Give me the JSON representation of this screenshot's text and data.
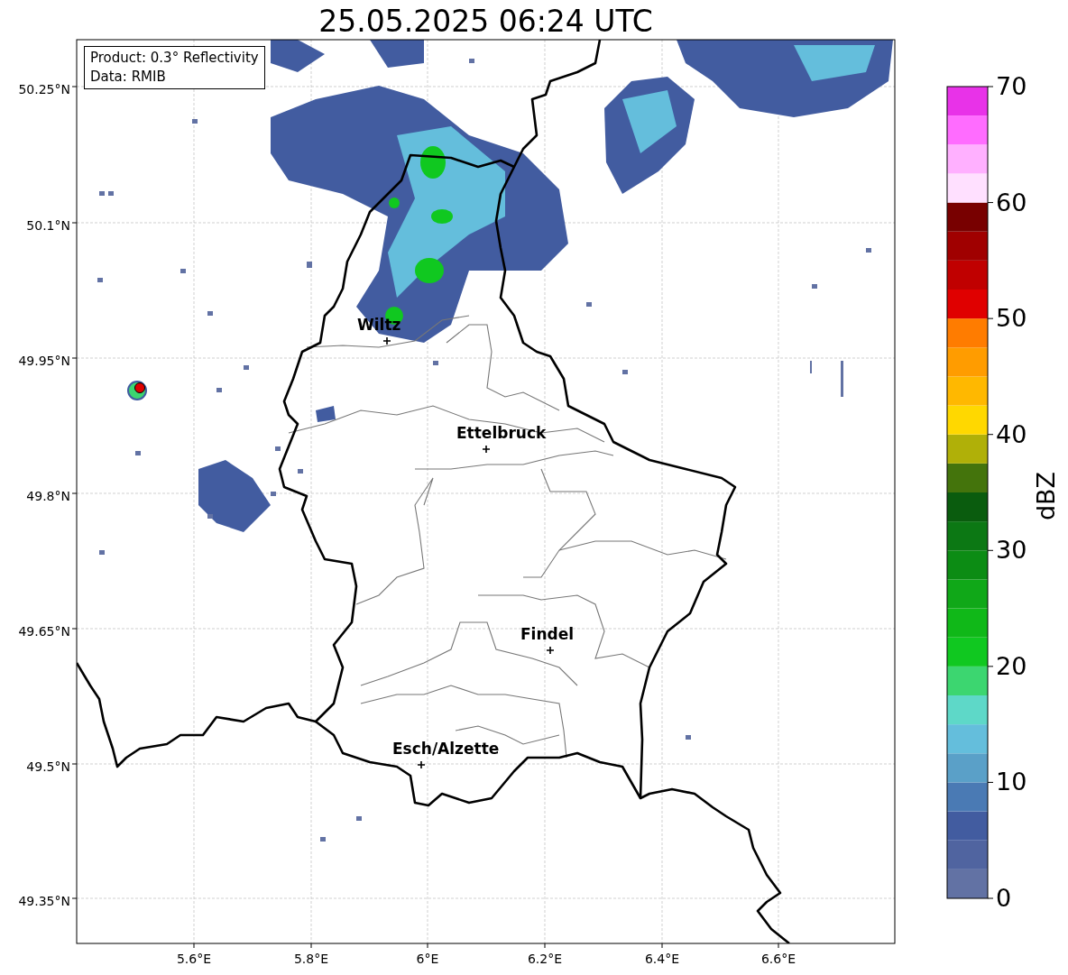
{
  "title": "25.05.2025 06:24 UTC",
  "info_box": {
    "lines": [
      "Product: 0.3° Reflectivity",
      "Data: RMIB"
    ]
  },
  "map": {
    "x_ticks": [
      "5.6°E",
      "5.8°E",
      "6°E",
      "6.2°E",
      "6.4°E",
      "6.6°E"
    ],
    "y_ticks": [
      "50.25°N",
      "50.1°N",
      "49.95°N",
      "49.8°N",
      "49.65°N",
      "49.5°N",
      "49.35°N"
    ],
    "places": [
      {
        "name": "Wiltz"
      },
      {
        "name": "Ettelbruck"
      },
      {
        "name": "Findel"
      },
      {
        "name": "Esch/Alzette"
      }
    ]
  },
  "colorbar": {
    "label": "dBZ",
    "ticks": [
      "70",
      "60",
      "50",
      "40",
      "30",
      "20",
      "10",
      "0"
    ],
    "bands": [
      {
        "color": "#6272a4"
      },
      {
        "color": "#5064a0"
      },
      {
        "color": "#425ca0"
      },
      {
        "color": "#4a7ab4"
      },
      {
        "color": "#5aa0c8"
      },
      {
        "color": "#64bedc"
      },
      {
        "color": "#5ed8c8"
      },
      {
        "color": "#3cd670"
      },
      {
        "color": "#10c820"
      },
      {
        "color": "#10b818"
      },
      {
        "color": "#10a818"
      },
      {
        "color": "#0c8c14"
      },
      {
        "color": "#0c7814"
      },
      {
        "color": "#0a5c0e"
      },
      {
        "color": "#44740c"
      },
      {
        "color": "#b0b008"
      },
      {
        "color": "#ffd800"
      },
      {
        "color": "#ffb800"
      },
      {
        "color": "#ff9c00"
      },
      {
        "color": "#ff7c00"
      },
      {
        "color": "#e00000"
      },
      {
        "color": "#c00000"
      },
      {
        "color": "#a00000"
      },
      {
        "color": "#780000"
      },
      {
        "color": "#ffe0ff"
      },
      {
        "color": "#ffb0ff"
      },
      {
        "color": "#ff6cff"
      },
      {
        "color": "#e832e8"
      }
    ]
  }
}
